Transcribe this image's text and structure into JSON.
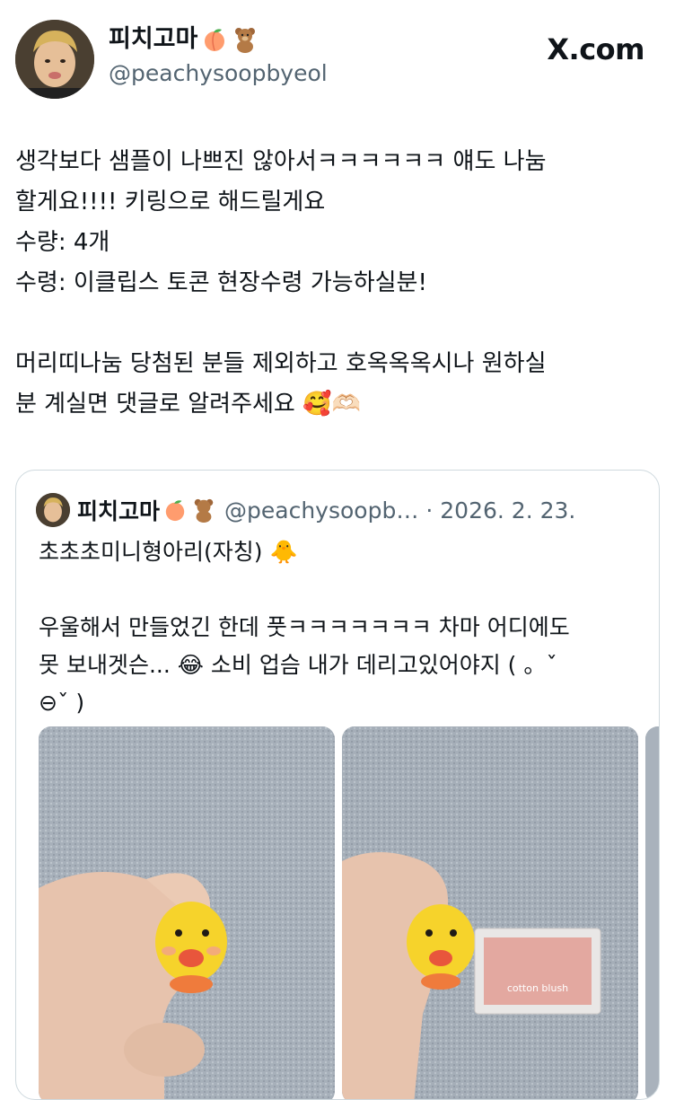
{
  "site": "X.com",
  "author": {
    "display_name": "피치고마",
    "name_emojis": [
      "peach",
      "teddy-bear"
    ],
    "handle": "@peachysoopbyeol"
  },
  "tweet": {
    "text": "생각보다 샘플이 나쁘진 않아서ㅋㅋㅋㅋㅋㅋ 얘도 나눔\n할게요!!!! 키링으로 해드릴게요\n수량: 4개\n수령: 이클립스 토콘 현장수령 가능하실분!\n\n머리띠나눔 당첨된 분들 제외하고 호옥옥옥시나 원하실\n분 계실면 댓글로 알려주세요 🥰🫶🏻"
  },
  "quote": {
    "display_name": "피치고마",
    "handle": "@peachysoopb…",
    "separator": "·",
    "date": "2026. 2. 23.",
    "text": "초초초미니형아리(자칭) 🐥\n\n우울해서 만들었긴 한데 풋ㅋㅋㅋㅋㅋㅋㅋ 차마 어디에도\n못 보내겟슨... 😂 소비 업슴 내가 데리고있어야지 ( 。ˇ\n⊖ˇ )",
    "photos": [
      {
        "subject": "yellow crocheted chick keychain held in hand"
      },
      {
        "subject": "crocheted chick next to cosmetic compact",
        "label": "cotton blush"
      },
      {
        "subject": "third photo partially visible"
      }
    ]
  },
  "colors": {
    "text": "#0f1419",
    "secondary": "#536471",
    "border": "#cfd9de",
    "chick": "#f6d32b",
    "beak": "#e8563c"
  }
}
